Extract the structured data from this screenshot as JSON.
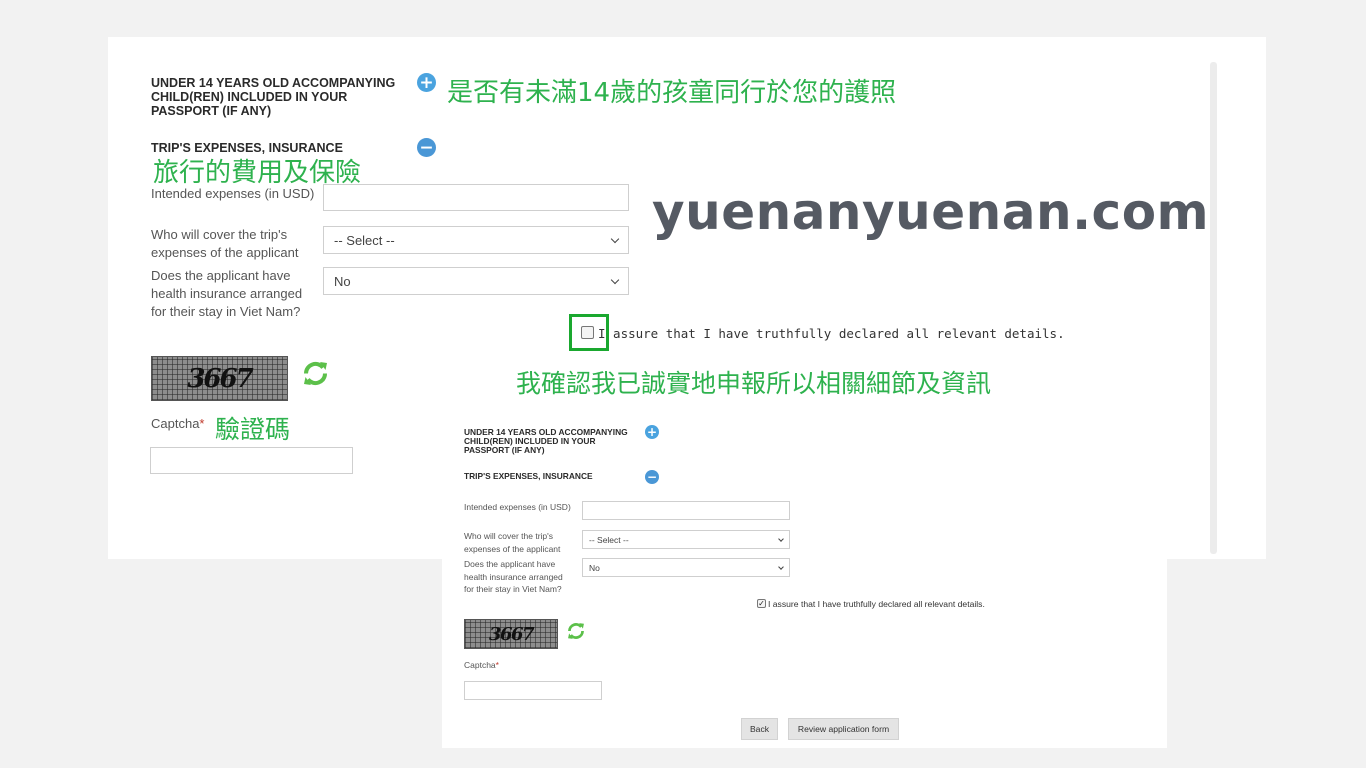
{
  "large": {
    "section1": {
      "title": "UNDER 14 YEARS OLD ACCOMPANYING CHILD(REN) INCLUDED IN YOUR PASSPORT (IF ANY)"
    },
    "section2": {
      "title": "TRIP'S EXPENSES, INSURANCE"
    },
    "intended_label": "Intended expenses (in USD)",
    "intended_value": "",
    "cover_label": "Who will cover the trip's expenses of the applicant",
    "cover_value": "-- Select --",
    "insurance_label": "Does the applicant have health insurance arranged for their stay in Viet Nam?",
    "insurance_value": "No",
    "assure_label": "I assure that I have truthfully declared all relevant details.",
    "assure_checked": false,
    "captcha_text": "3667",
    "captcha_label": "Captcha",
    "captcha_required": "*",
    "captcha_value": ""
  },
  "small": {
    "section1": {
      "title": "UNDER 14 YEARS OLD ACCOMPANYING CHILD(REN) INCLUDED IN YOUR PASSPORT (IF ANY)"
    },
    "section2": {
      "title": "TRIP'S EXPENSES, INSURANCE"
    },
    "intended_label": "Intended expenses (in USD)",
    "cover_label": "Who will cover the trip's expenses of the applicant",
    "cover_value": "-- Select --",
    "insurance_label": "Does the applicant have health insurance arranged for their stay in Viet Nam?",
    "insurance_value": "No",
    "assure_label": "I assure that I have truthfully declared all relevant details.",
    "assure_checked": true,
    "captcha_text": "3667",
    "captcha_label": "Captcha",
    "captcha_required": "*",
    "back_button": "Back",
    "review_button": "Review application form"
  },
  "annotations": {
    "children_zh": "是否有未滿14歲的孩童同行於您的護照",
    "expenses_zh": "旅行的費用及保險",
    "assure_zh": "我確認我已誠實地申報所以相關細節及資訊",
    "captcha_zh": "驗證碼",
    "watermark": "yuenanyuenan.com"
  },
  "colors": {
    "annotation_green": "#2eb24e",
    "highlight_box": "#1aa82f",
    "plus_icon": "#4aa3df",
    "minus_icon": "#4a97d6",
    "required": "#c0392b",
    "refresh_icon": "#5cc04a"
  },
  "icons": {
    "expand": "plus-circle-icon",
    "collapse": "minus-circle-icon",
    "refresh": "refresh-icon",
    "dropdown": "chevron-down-icon"
  }
}
